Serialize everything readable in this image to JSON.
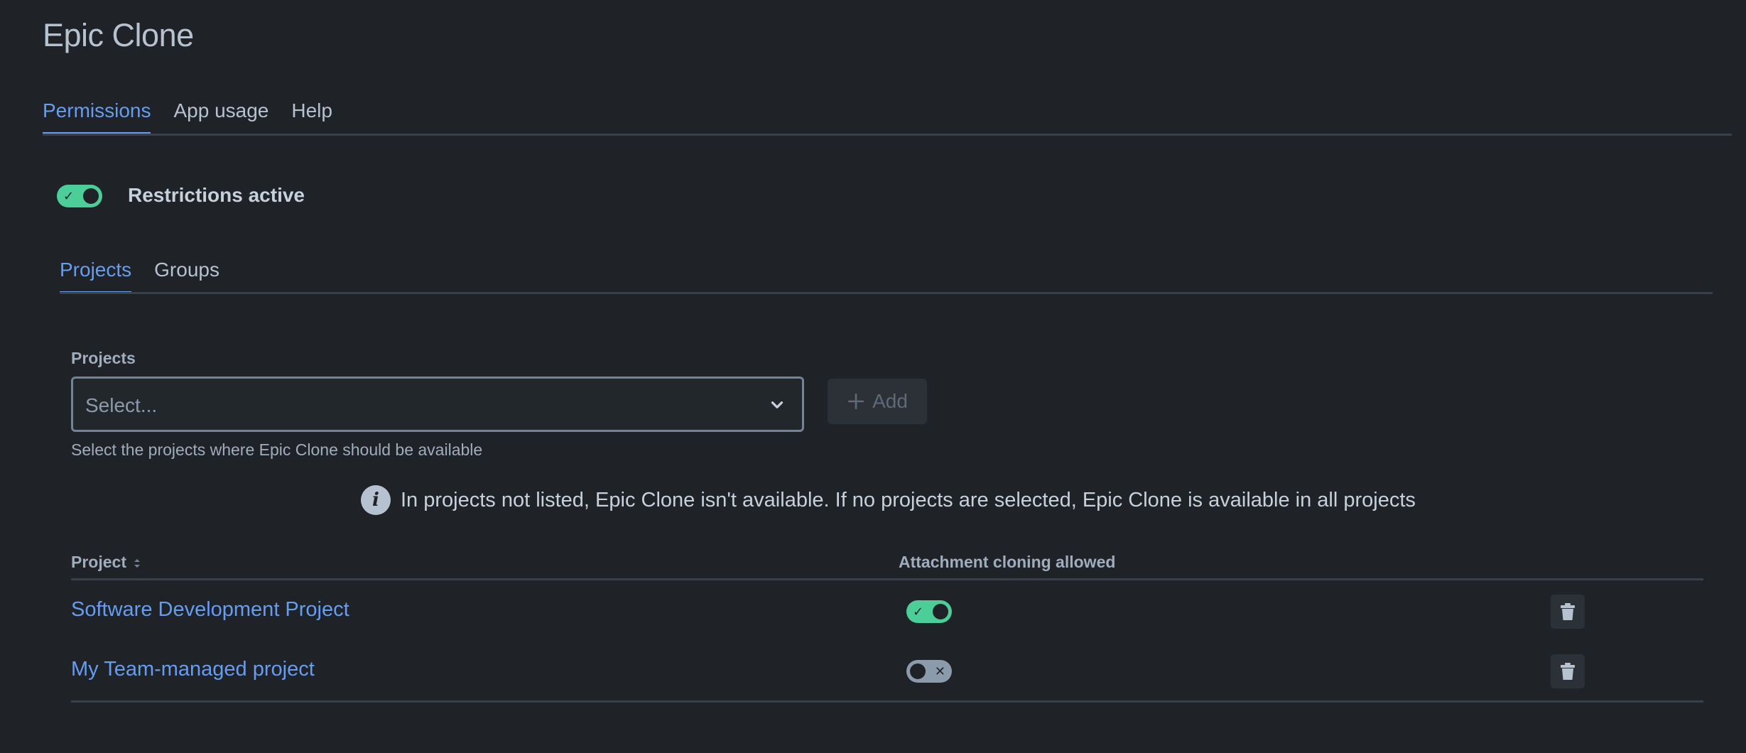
{
  "app": {
    "title": "Epic Clone"
  },
  "top_tabs": [
    {
      "label": "Permissions",
      "active": true
    },
    {
      "label": "App usage",
      "active": false
    },
    {
      "label": "Help",
      "active": false
    }
  ],
  "restrictions": {
    "label": "Restrictions active",
    "enabled": true
  },
  "inner_tabs": [
    {
      "label": "Projects",
      "active": true
    },
    {
      "label": "Groups",
      "active": false
    }
  ],
  "projects_field": {
    "label": "Projects",
    "placeholder": "Select...",
    "helper": "Select the projects where Epic Clone should be available",
    "add_label": "Add",
    "add_enabled": false
  },
  "info": {
    "text": "In projects not listed, Epic Clone isn't available. If no projects are selected, Epic Clone is available in all projects"
  },
  "table": {
    "columns": [
      "Project",
      "Attachment cloning allowed"
    ],
    "rows": [
      {
        "project": "Software Development Project",
        "attachment_cloning": true
      },
      {
        "project": "My Team-managed project",
        "attachment_cloning": false
      }
    ]
  },
  "colors": {
    "background": "#1f2227",
    "accent": "#669df1",
    "toggle_on": "#4bce97",
    "toggle_off": "#8c9bab"
  },
  "icons": {
    "toggle_on": "check-icon",
    "toggle_off": "cross-icon",
    "select": "chevron-down-icon",
    "add": "plus-icon",
    "info": "info-icon",
    "sort": "sort-icon",
    "delete": "trash-icon"
  }
}
